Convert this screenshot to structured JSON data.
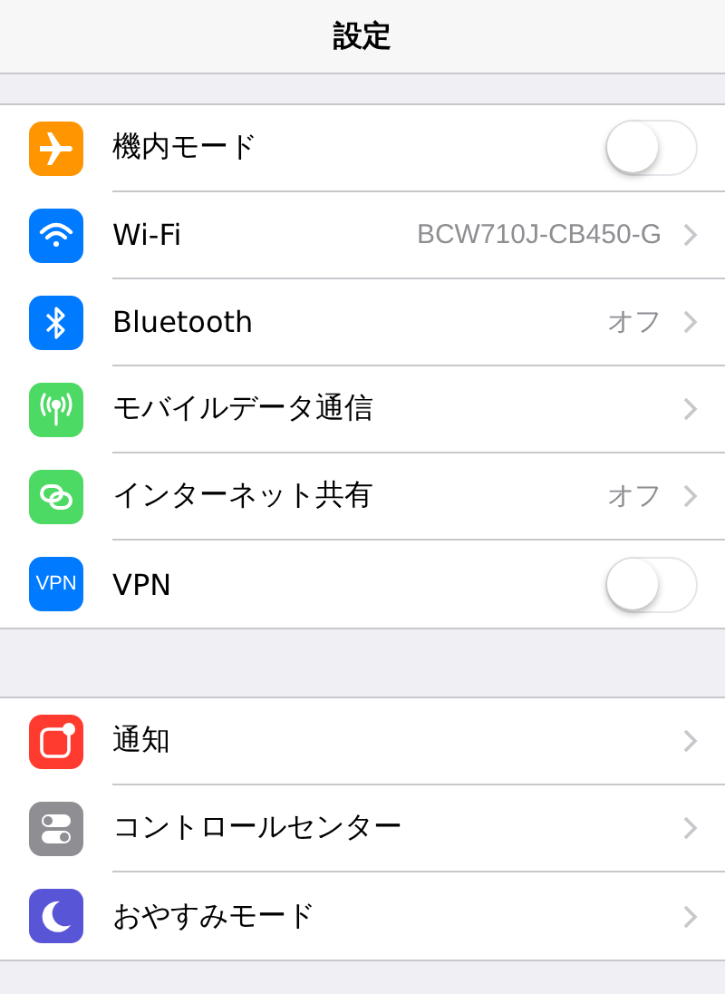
{
  "nav": {
    "title": "設定"
  },
  "sections": [
    {
      "rows": [
        {
          "kind": "toggle",
          "label": "機内モード",
          "color": "#ff9500",
          "on": false
        },
        {
          "kind": "link",
          "label": "Wi-Fi",
          "value": "BCW710J-CB450-G",
          "color": "#007aff"
        },
        {
          "kind": "link",
          "label": "Bluetooth",
          "value": "オフ",
          "color": "#007aff"
        },
        {
          "kind": "link",
          "label": "モバイルデータ通信",
          "color": "#4cd964"
        },
        {
          "kind": "link",
          "label": "インターネット共有",
          "value": "オフ",
          "color": "#4cd964"
        },
        {
          "kind": "toggle",
          "label": "VPN",
          "icon_text": "VPN",
          "color": "#007aff",
          "on": false
        }
      ]
    },
    {
      "rows": [
        {
          "kind": "link",
          "label": "通知",
          "color": "#ff3b30"
        },
        {
          "kind": "link",
          "label": "コントロールセンター",
          "color": "#8e8e93"
        },
        {
          "kind": "link",
          "label": "おやすみモード",
          "color": "#5856d6"
        }
      ]
    }
  ]
}
